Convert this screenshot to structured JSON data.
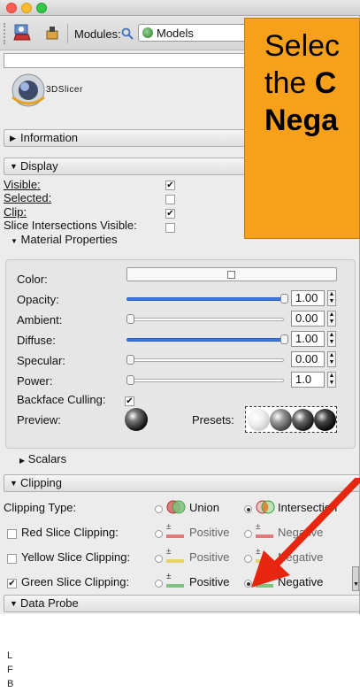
{
  "toolbar": {
    "modules_label": "Modules:",
    "module_selected": "Models"
  },
  "logo": {
    "text": "3DSlicer"
  },
  "sections": {
    "information": "Information",
    "display": "Display",
    "clipping": "Clipping",
    "data_probe": "Data Probe"
  },
  "display": {
    "visible": {
      "label": "Visible:",
      "checked": true
    },
    "selected": {
      "label": "Selected:",
      "checked": false
    },
    "clip": {
      "label": "Clip:",
      "checked": true
    },
    "slice_intersections": {
      "label": "Slice Intersections Visible:",
      "checked": false
    },
    "material_properties": "Material Properties",
    "color_label": "Color:",
    "opacity": {
      "label": "Opacity:",
      "value": "1.00",
      "fraction": 1.0
    },
    "ambient": {
      "label": "Ambient:",
      "value": "0.00",
      "fraction": 0.0
    },
    "diffuse": {
      "label": "Diffuse:",
      "value": "1.00",
      "fraction": 1.0
    },
    "specular": {
      "label": "Specular:",
      "value": "0.00",
      "fraction": 0.0
    },
    "power": {
      "label": "Power:",
      "value": "1.0",
      "fraction": 0.0
    },
    "backface": {
      "label": "Backface Culling:",
      "checked": true
    },
    "preview_label": "Preview:",
    "presets_label": "Presets:",
    "scalars": "Scalars"
  },
  "clipping": {
    "type_label": "Clipping Type:",
    "union": "Union",
    "intersection": "Intersection",
    "rows": [
      {
        "label": "Red Slice Clipping:",
        "checked": false,
        "positive": "Positive",
        "negative": "Negative",
        "color": "#e07a7a"
      },
      {
        "label": "Yellow Slice Clipping:",
        "checked": false,
        "positive": "Positive",
        "negative": "Negative",
        "color": "#e6d36a"
      },
      {
        "label": "Green Slice Clipping:",
        "checked": true,
        "positive": "Positive",
        "negative": "Negative",
        "color": "#7cc47c"
      }
    ]
  },
  "callout": {
    "line1": "Selec",
    "line2_a": "the ",
    "line2_b": "C",
    "line3": "Nega"
  },
  "axis_labels": [
    "L",
    "F",
    "B"
  ],
  "colors": {
    "callout": "#f7a11a",
    "arrow": "#e8260f",
    "slider": "#3b78e7"
  }
}
